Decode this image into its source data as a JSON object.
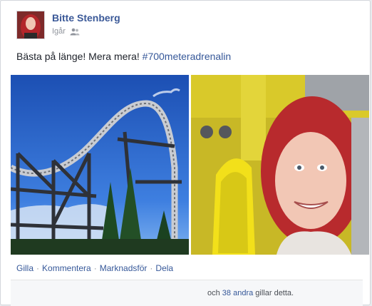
{
  "post": {
    "author": "Bitte Stenberg",
    "time": "Igår",
    "audience_icon": "friends-icon",
    "status_text": "Bästa på länge! Mera mera! ",
    "hashtag": "#700meteradrenalin",
    "photos": [
      {
        "name": "roller-coaster-photo",
        "subject": "roller coaster track against blue sky"
      },
      {
        "name": "selfie-photo",
        "subject": "woman with red hair smiling on yellow ride seat"
      }
    ],
    "actions": {
      "like": "Gilla",
      "comment": "Kommentera",
      "promote": "Marknadsför",
      "share": "Dela",
      "separator": "·"
    },
    "likes": {
      "prefix": "och ",
      "others_link": "38 andra",
      "suffix": " gillar detta."
    }
  },
  "colors": {
    "link": "#365899",
    "author": "#3b5998",
    "text": "#1d2129",
    "meta": "#90949c"
  }
}
